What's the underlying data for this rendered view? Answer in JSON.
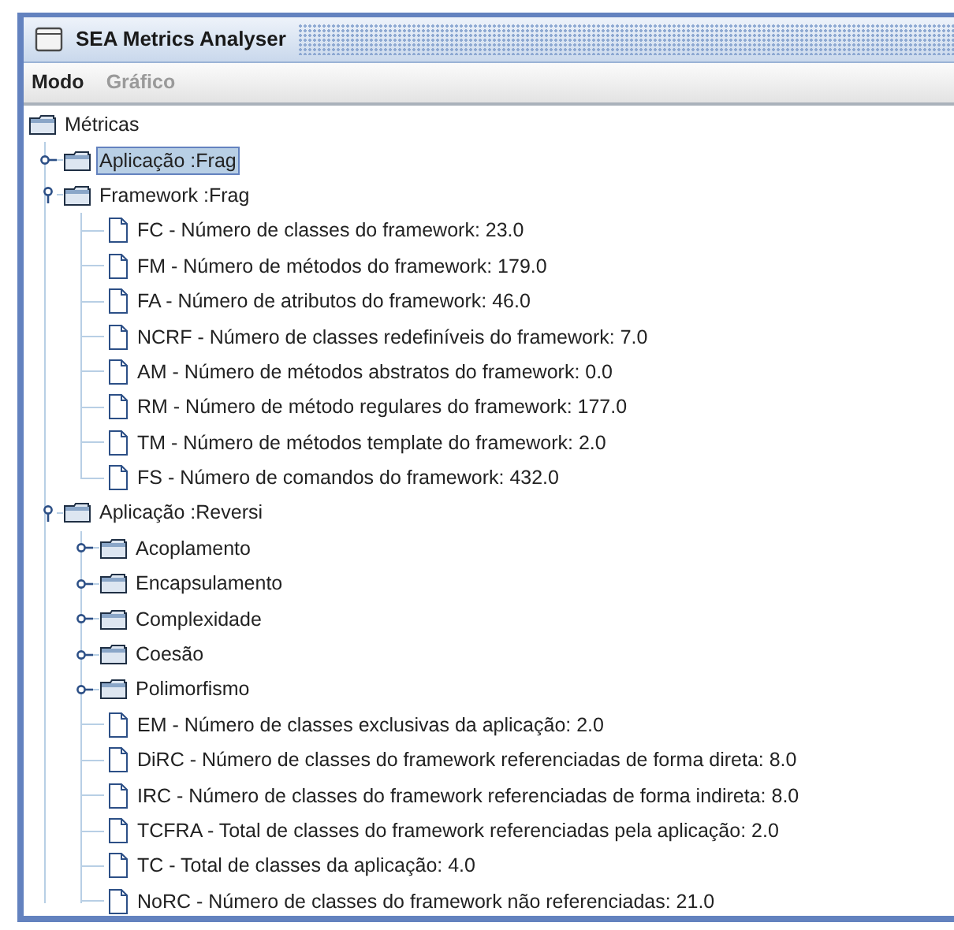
{
  "window": {
    "title": "SEA Metrics Analyser"
  },
  "menu": [
    {
      "label": "Modo",
      "disabled": false
    },
    {
      "label": "Gráfico",
      "disabled": true
    }
  ],
  "tree": {
    "label": "Métricas",
    "kind": "folder",
    "selected": false,
    "children": [
      {
        "label": "Aplicação :Frag",
        "kind": "folder",
        "expanded": false,
        "selected": true
      },
      {
        "label": "Framework :Frag",
        "kind": "folder",
        "expanded": true,
        "selected": false,
        "children": [
          {
            "label": "FC - Número de classes do framework: 23.0",
            "kind": "leaf",
            "selected": false
          },
          {
            "label": "FM - Número de métodos do framework: 179.0",
            "kind": "leaf",
            "selected": false
          },
          {
            "label": "FA - Número de atributos do framework: 46.0",
            "kind": "leaf",
            "selected": false
          },
          {
            "label": "NCRF - Número de classes redefiníveis do framework: 7.0",
            "kind": "leaf",
            "selected": false
          },
          {
            "label": "AM - Número de métodos abstratos do framework: 0.0",
            "kind": "leaf",
            "selected": false
          },
          {
            "label": "RM - Número de método regulares do framework: 177.0",
            "kind": "leaf",
            "selected": false
          },
          {
            "label": "TM - Número de métodos template do framework: 2.0",
            "kind": "leaf",
            "selected": false
          },
          {
            "label": "FS - Número de comandos do framework: 432.0",
            "kind": "leaf",
            "selected": false
          }
        ]
      },
      {
        "label": "Aplicação :Reversi",
        "kind": "folder",
        "expanded": true,
        "selected": false,
        "children": [
          {
            "label": "Acoplamento",
            "kind": "folder",
            "expanded": false,
            "selected": false
          },
          {
            "label": "Encapsulamento",
            "kind": "folder",
            "expanded": false,
            "selected": false
          },
          {
            "label": "Complexidade",
            "kind": "folder",
            "expanded": false,
            "selected": false
          },
          {
            "label": "Coesão",
            "kind": "folder",
            "expanded": false,
            "selected": false
          },
          {
            "label": "Polimorfismo",
            "kind": "folder",
            "expanded": false,
            "selected": false
          },
          {
            "label": "EM - Número de classes exclusivas da aplicação: 2.0",
            "kind": "leaf",
            "selected": false
          },
          {
            "label": "DiRC - Número de classes do framework referenciadas de forma direta: 8.0",
            "kind": "leaf",
            "selected": false
          },
          {
            "label": "IRC - Número de classes do framework referenciadas de forma indireta: 8.0",
            "kind": "leaf",
            "selected": false
          },
          {
            "label": "TCFRA - Total de classes do framework referenciadas pela aplicação: 2.0",
            "kind": "leaf",
            "selected": false
          },
          {
            "label": "TC - Total de classes da aplicação: 4.0",
            "kind": "leaf",
            "selected": false
          },
          {
            "label": "NoRC - Número de classes do framework não referenciadas: 21.0",
            "kind": "leaf",
            "selected": false
          }
        ]
      }
    ]
  }
}
